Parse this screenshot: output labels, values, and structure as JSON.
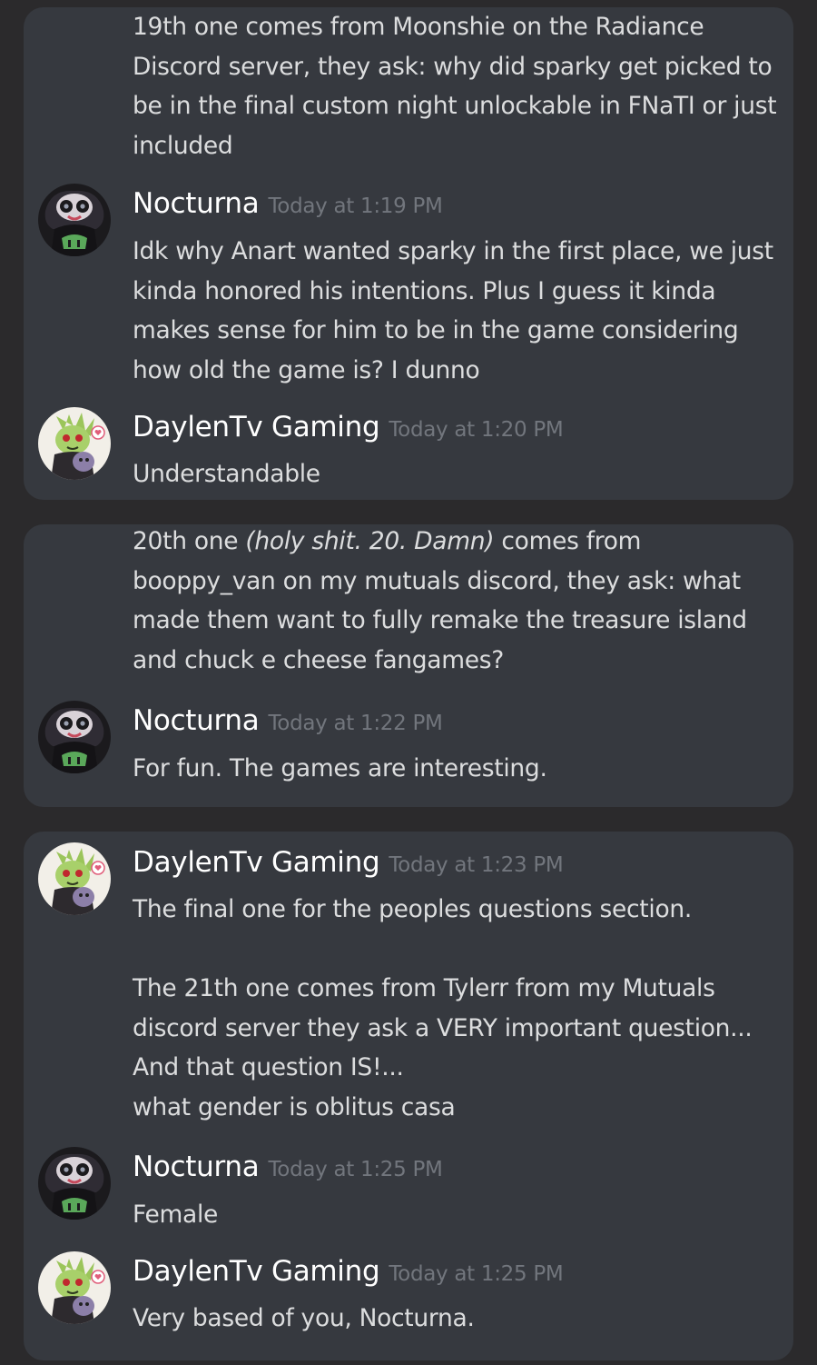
{
  "messages": {
    "m1_body": "19th one comes from Moonshie on the Radiance Discord server, they ask: why did sparky get picked to be in the final custom night unlockable in FNaTI or just included",
    "m2": {
      "author": "Nocturna",
      "time": "Today at 1:19 PM",
      "body": "Idk why Anart wanted sparky in the first place, we just kinda honored his intentions. Plus I guess it kinda makes sense for him to be in the game considering how old the game is? I dunno"
    },
    "m3": {
      "author": "DaylenTv Gaming",
      "time": "Today at 1:20 PM",
      "body": "Understandable"
    },
    "m4": {
      "prefix": "20th one ",
      "italic": "(holy shit. 20. Damn)",
      "suffix": " comes from booppy_van on my mutuals discord, they ask: what made them want to fully remake the treasure island and chuck e cheese fangames?"
    },
    "m5": {
      "author": "Nocturna",
      "time": "Today at 1:22 PM",
      "body": "For fun. The games are interesting."
    },
    "m6": {
      "author": "DaylenTv Gaming",
      "time": "Today at 1:23 PM",
      "body": "The final one for the peoples questions section.\n\nThe 21th one comes from Tylerr from my Mutuals discord server they ask a VERY important question...\nAnd that question IS!...\nwhat gender is oblitus casa"
    },
    "m7": {
      "author": "Nocturna",
      "time": "Today at 1:25 PM",
      "body": "Female"
    },
    "m8": {
      "author": "DaylenTv Gaming",
      "time": "Today at 1:25 PM",
      "body": "Very based of you, Nocturna."
    }
  },
  "colors": {
    "page_bg": "#2b2a2c",
    "card_bg": "#36393f",
    "text": "#dcddde",
    "username": "#ffffff",
    "timestamp": "#72767d"
  },
  "icons": {
    "nocturna_avatar": "dark-animatronic-avatar",
    "daylen_avatar": "green-plush-avatar"
  }
}
